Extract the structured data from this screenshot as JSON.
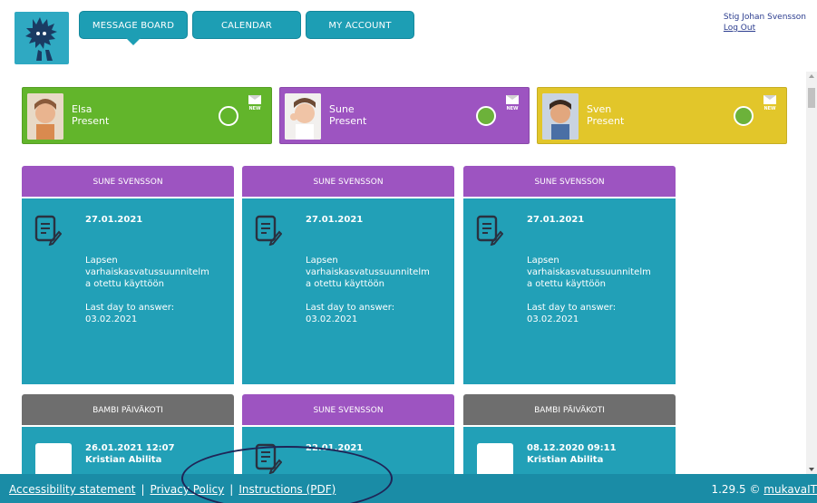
{
  "header": {
    "nav": [
      "MESSAGE BOARD",
      "CALENDAR",
      "MY ACCOUNT"
    ],
    "user_name": "Stig Johan Svensson",
    "logout": "Log Out"
  },
  "children": [
    {
      "name": "Elsa",
      "status": "Present",
      "color": "#62b52b",
      "status_filled": false
    },
    {
      "name": "Sune",
      "status": "Present",
      "color": "#9d54c1",
      "status_filled": true
    },
    {
      "name": "Sven",
      "status": "Present",
      "color": "#e2c62a",
      "status_filled": true
    }
  ],
  "new_badge": "NEW",
  "messages": [
    {
      "header": "SUNE SVENSSON",
      "date": "27.01.2021",
      "line1": "Lapsen",
      "line2": "varhaiskasvatussuunnitelm",
      "line3": "a otettu käyttöön",
      "line4": "Last day to answer:",
      "line5": "03.02.2021"
    },
    {
      "header": "SUNE SVENSSON",
      "date": "27.01.2021",
      "line1": "Lapsen",
      "line2": "varhaiskasvatussuunnitelm",
      "line3": "a otettu käyttöön",
      "line4": "Last day to answer:",
      "line5": "03.02.2021"
    },
    {
      "header": "SUNE SVENSSON",
      "date": "27.01.2021",
      "line1": "Lapsen",
      "line2": "varhaiskasvatussuunnitelm",
      "line3": "a otettu käyttöön",
      "line4": "Last day to answer:",
      "line5": "03.02.2021"
    },
    {
      "header": "BAMBI PÄIVÄKOTI",
      "date": "26.01.2021 12:07",
      "sender": "Kristian Abilita"
    },
    {
      "header": "SUNE SVENSSON",
      "date": "22.01.2021"
    },
    {
      "header": "BAMBI PÄIVÄKOTI",
      "date": "08.12.2020 09:11",
      "sender": "Kristian Abilita"
    }
  ],
  "footer": {
    "accessibility": "Accessibility statement",
    "privacy": "Privacy Policy",
    "instructions": "Instructions (PDF)",
    "separator": "|",
    "version": "1.29.5 ©",
    "brand": "mukavaIT"
  }
}
